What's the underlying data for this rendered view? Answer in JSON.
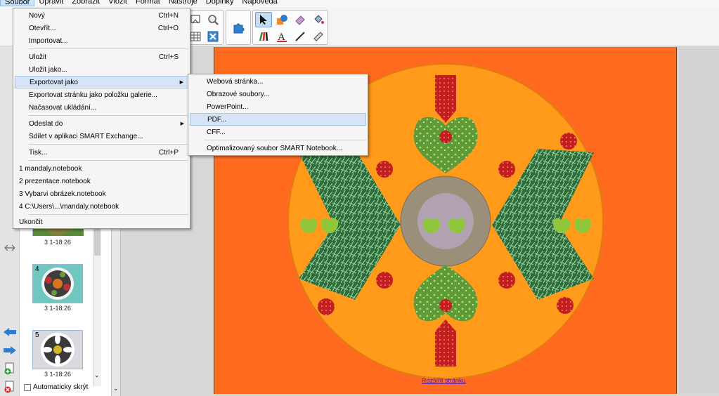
{
  "menubar": [
    "Soubor",
    "Upravit",
    "Zobrazit",
    "Vložit",
    "Formát",
    "Nástroje",
    "Doplňky",
    "Nápověda"
  ],
  "file_menu": {
    "items": [
      {
        "label": "Nový",
        "shortcut": "Ctrl+N"
      },
      {
        "label": "Otevřít...",
        "shortcut": "Ctrl+O"
      },
      {
        "label": "Importovat...",
        "shortcut": ""
      },
      {
        "label": "Uložit",
        "shortcut": "Ctrl+S"
      },
      {
        "label": "Uložit jako...",
        "shortcut": ""
      },
      {
        "label": "Exportovat jako",
        "shortcut": ""
      },
      {
        "label": "Exportovat stránku jako položku galerie...",
        "shortcut": ""
      },
      {
        "label": "Načasovat ukládání...",
        "shortcut": ""
      },
      {
        "label": "Odeslat do",
        "shortcut": ""
      },
      {
        "label": "Sdílet v aplikaci SMART Exchange...",
        "shortcut": ""
      },
      {
        "label": "Tisk...",
        "shortcut": "Ctrl+P"
      },
      {
        "label": "1 mandaly.notebook",
        "shortcut": ""
      },
      {
        "label": "2 prezentace.notebook",
        "shortcut": ""
      },
      {
        "label": "3 Vybarvi obrázek.notebook",
        "shortcut": ""
      },
      {
        "label": "4 C:\\Users\\...\\mandaly.notebook",
        "shortcut": ""
      },
      {
        "label": "Ukončit",
        "shortcut": ""
      }
    ]
  },
  "export_submenu": {
    "items": [
      {
        "label": "Webová stránka..."
      },
      {
        "label": "Obrazové soubory..."
      },
      {
        "label": "PowerPoint..."
      },
      {
        "label": "PDF..."
      },
      {
        "label": "CFF..."
      },
      {
        "label": "Optimalizovaný soubor SMART Notebook..."
      }
    ]
  },
  "sorter": {
    "thumbs": [
      {
        "num": "",
        "caption": "3 1-18:26"
      },
      {
        "num": "4",
        "caption": "3 1-18:26"
      },
      {
        "num": "5",
        "caption": "3 1-18:26"
      }
    ],
    "autohide_label": "Automaticky skrýt"
  },
  "canvas": {
    "expand_link": "Rozšířit stránku"
  },
  "colors": {
    "page_background": "#ff6a1f",
    "mandala_circle": "#ff9a1a",
    "menu_highlight": "#d5e5f7"
  }
}
